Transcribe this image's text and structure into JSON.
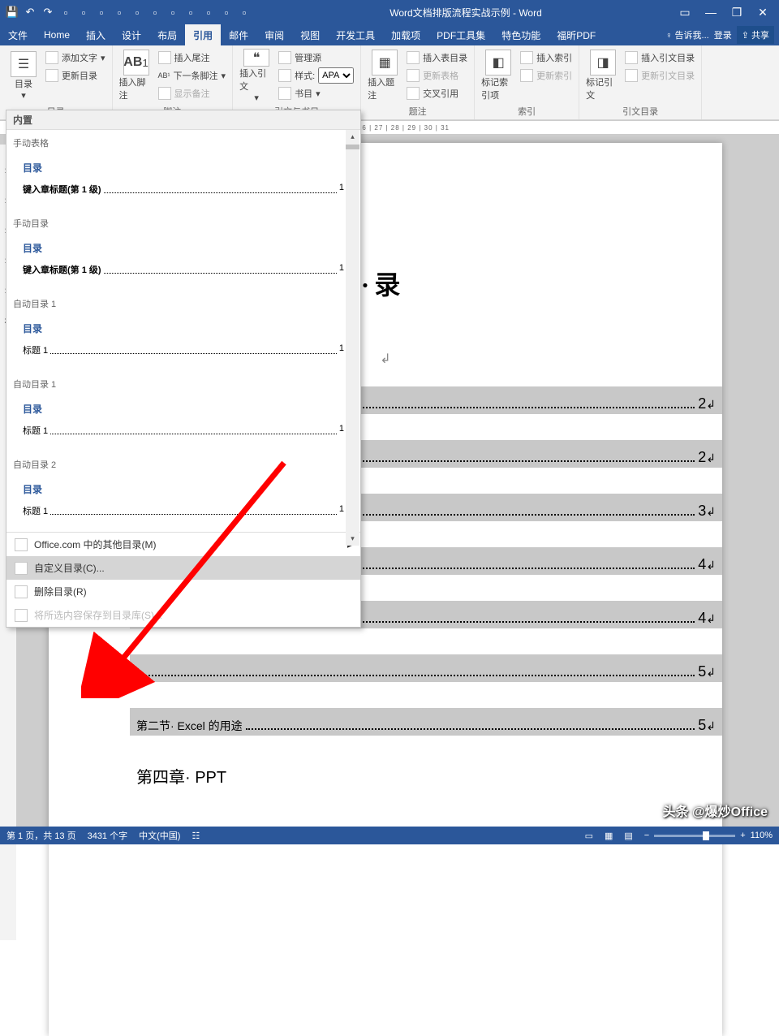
{
  "title": "Word文档排版流程实战示例 - Word",
  "tabs": [
    "文件",
    "Home",
    "插入",
    "设计",
    "布局",
    "引用",
    "邮件",
    "审阅",
    "视图",
    "开发工具",
    "加载项",
    "PDF工具集",
    "特色功能",
    "福昕PDF"
  ],
  "active_tab": 5,
  "tell_me": "告诉我...",
  "login": "登录",
  "share": "共享",
  "ribbon": {
    "toc_btn": "目录",
    "add_text": "添加文字",
    "update_toc": "更新目录",
    "insert_footnote": "插入脚注",
    "ab": "AB",
    "ab_sup": "1",
    "insert_endnote": "插入尾注",
    "next_footnote": "下一条脚注",
    "show_notes": "显示备注",
    "footnotes_label": "脚注",
    "insert_citation": "插入引文",
    "manage_sources": "管理源",
    "style": "样式:",
    "style_val": "APA",
    "bibliography": "书目",
    "citations_label": "引文与书目",
    "insert_caption": "插入题注",
    "insert_table_fig": "插入表目录",
    "update_table": "更新表格",
    "cross_ref": "交叉引用",
    "captions_label": "题注",
    "mark_entry": "标记索引项",
    "insert_index": "插入索引",
    "update_index": "更新索引",
    "index_label": "索引",
    "mark_citation": "标记引文",
    "insert_toa": "插入引文目录",
    "update_toa": "更新引文目录",
    "toa_label": "引文目录"
  },
  "ruler": "3  |  4  |  5  |  6  |  7  |  8  |  9  |  10  |  11  |  12  |  13  |  14  |  15  |  16  |  17  |  18  |  19  |  20  |  21  |  22  |  23  |  24  |  25  |  26  |  27  |  28  |  29  |  30  |  31",
  "menu": {
    "builtin": "内置",
    "cat1": "手动表格",
    "toc_label": "目录",
    "chapter": "键入章标题(第 1 级)",
    "pg1": "1",
    "cat2": "手动目录",
    "cat3": "自动目录 1",
    "heading1": "标题 1",
    "cat4": "自动目录 1",
    "cat5": "自动目录 2",
    "more_office": "Office.com 中的其他目录(M)",
    "custom": "自定义目录(C)...",
    "remove": "删除目录(R)",
    "save": "将所选内容保存到目录库(S)..."
  },
  "doc": {
    "title": "目··录",
    "rows": [
      {
        "txt": "",
        "pg": "2"
      },
      {
        "txt": "",
        "pg": "2"
      },
      {
        "txt": "",
        "pg": "3"
      },
      {
        "txt": "",
        "pg": "4"
      },
      {
        "txt": "",
        "pg": "4"
      },
      {
        "txt": "",
        "pg": "5"
      }
    ],
    "vis_line": "第二节· Excel 的用途",
    "vis_pg": "5",
    "vis_line2": "第四章· PPT"
  },
  "status": {
    "page": "第 1 页，共 13 页",
    "words": "3431 个字",
    "lang": "中文(中国)",
    "zoom": "110%"
  },
  "watermark": "头条 @爆炒Office"
}
